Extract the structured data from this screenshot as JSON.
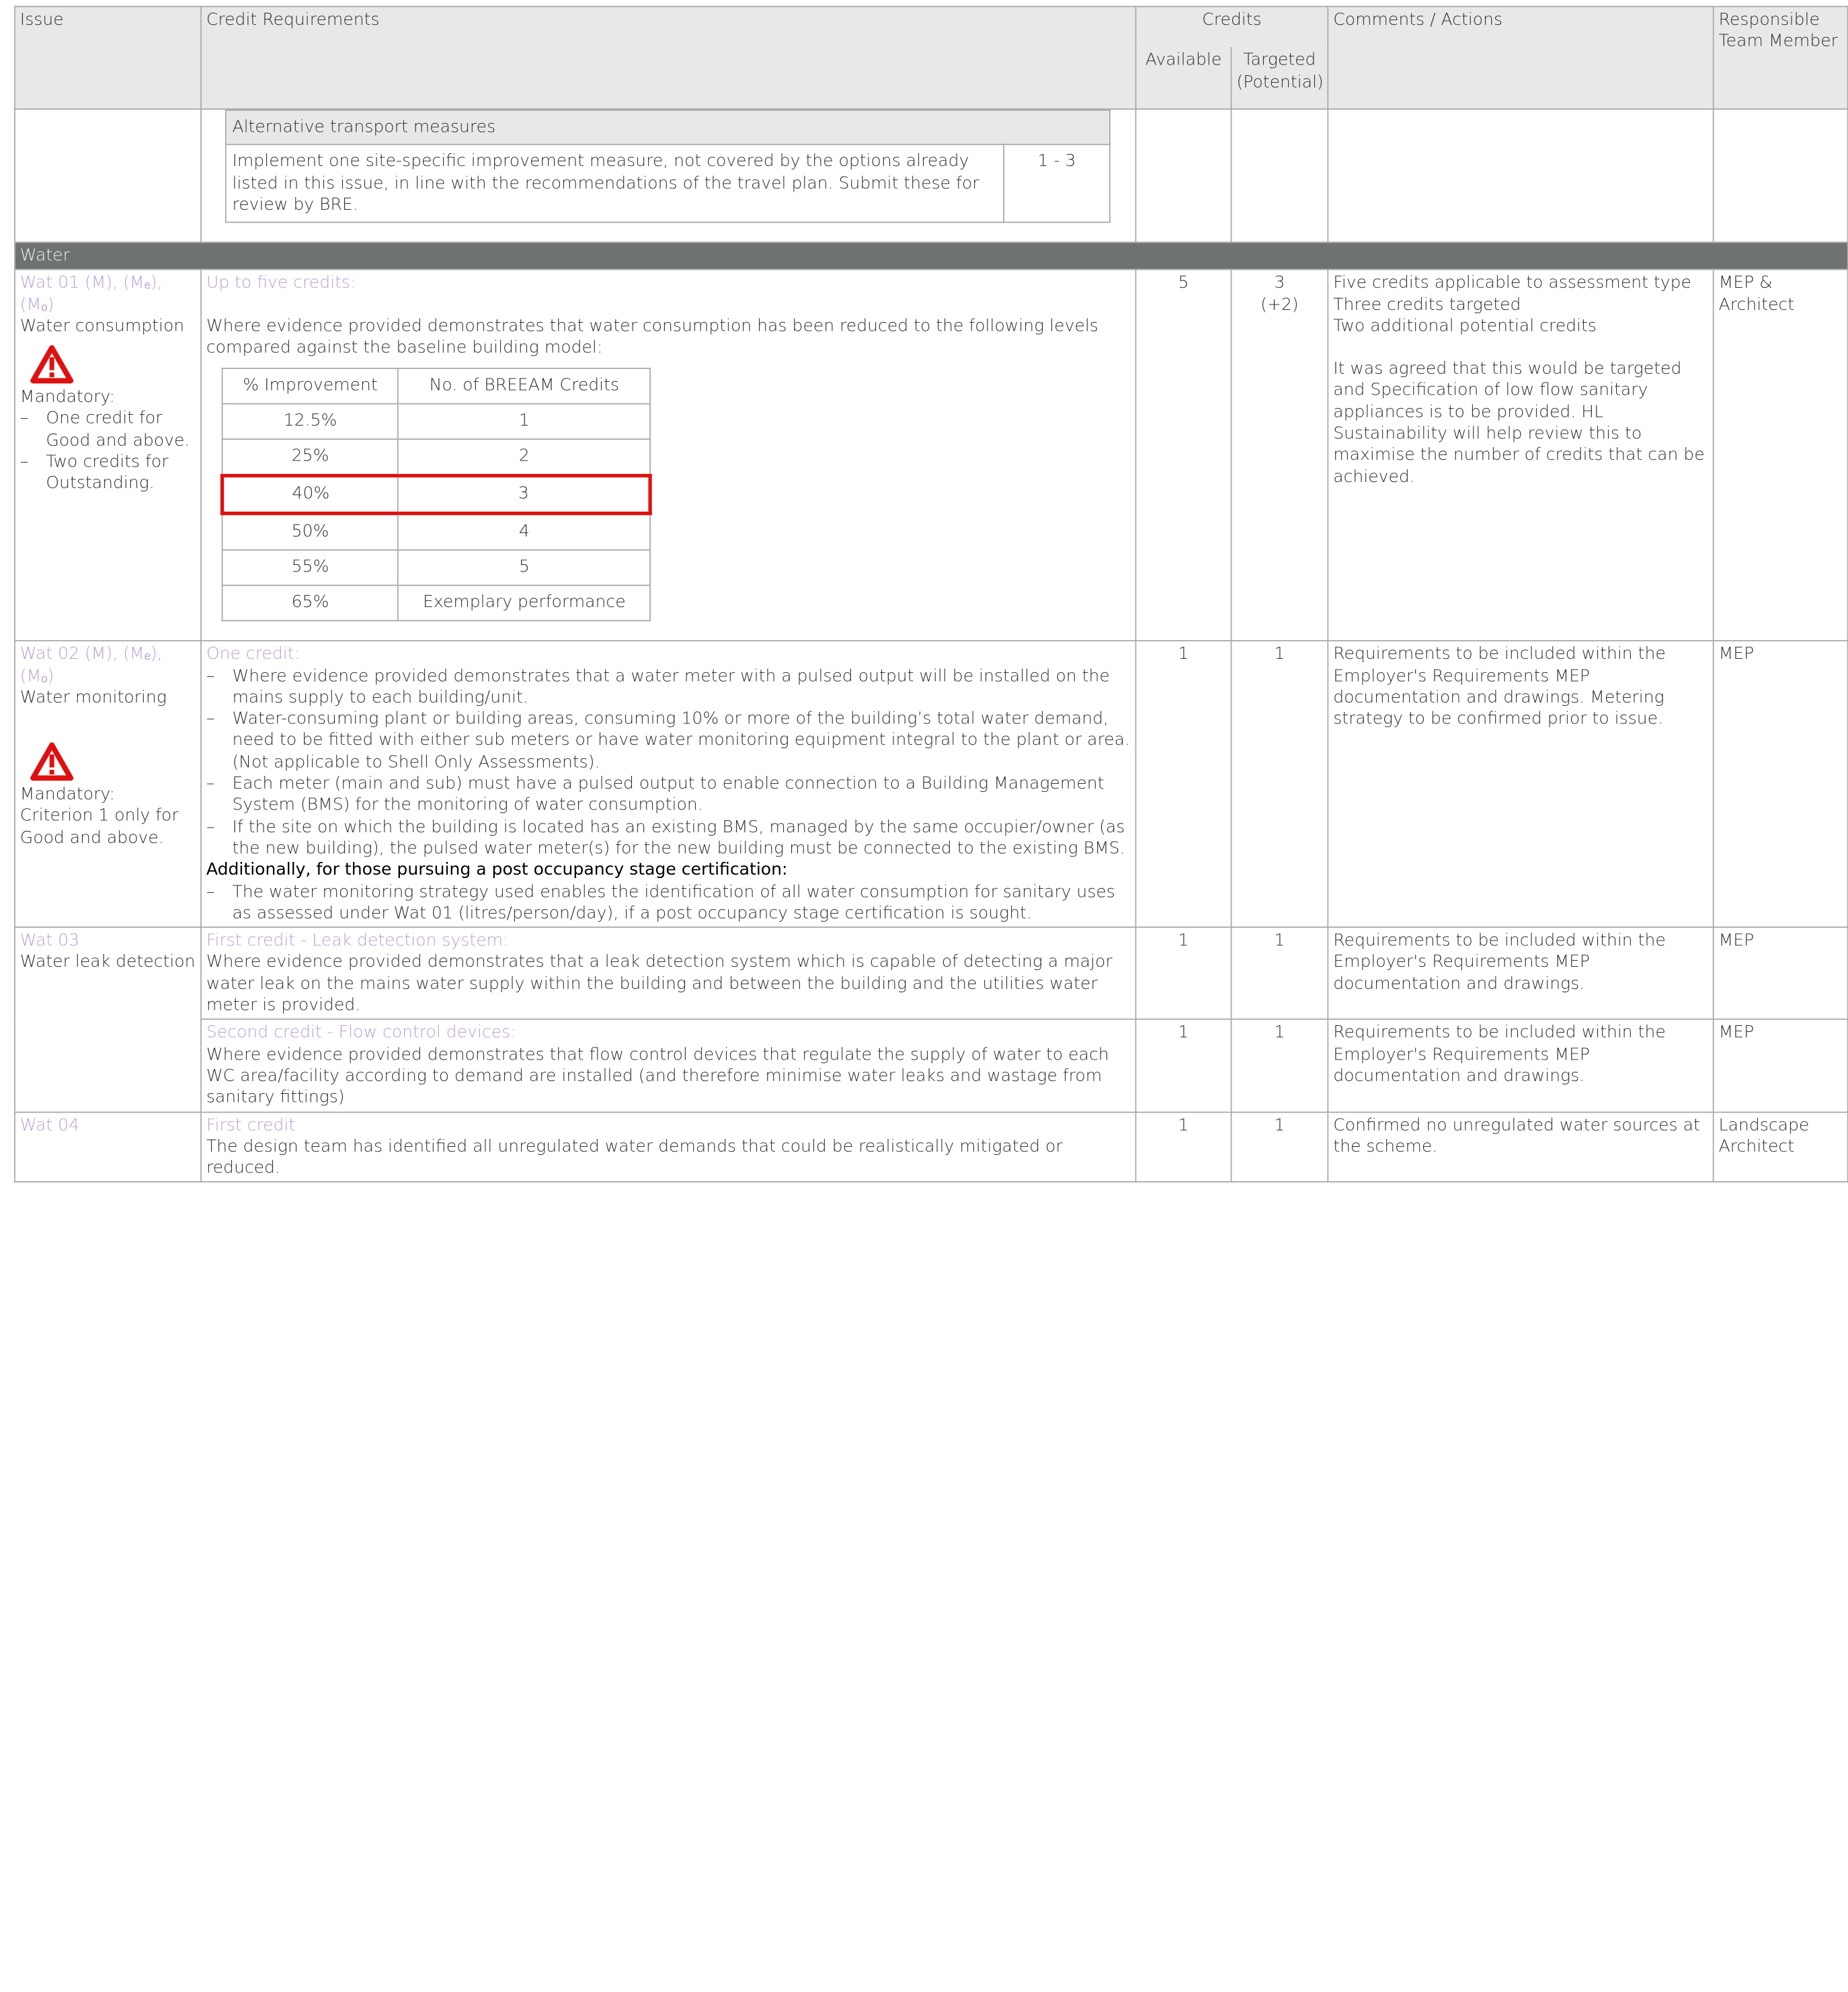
{
  "header": {
    "issue": "Issue",
    "credit_requirements": "Credit Requirements",
    "credits": "Credits",
    "available": "Available",
    "targeted": "Targeted",
    "potential": "(Potential)",
    "comments": "Comments / Actions",
    "responsible": "Responsible Team Member"
  },
  "alt_transport": {
    "title": "Alternative transport measures",
    "text": "Implement one site-specific improvement measure, not covered by the options already listed in this issue, in line with the recommendations of the travel plan. Submit these for review by BRE.",
    "credits": "1 - 3"
  },
  "section_water": "Water",
  "wat01": {
    "code": "Wat 01 (M), (Mₑ), (Mₒ)",
    "name": "Water consumption",
    "mandatory_title": "Mandatory:",
    "mandatory_items": [
      "One credit for Good and above.",
      "Two credits for Outstanding."
    ],
    "req_title": "Up to five credits:",
    "req_text": "Where evidence provided demonstrates that water consumption has been reduced to the following levels compared against the baseline building model:",
    "table_headers": [
      "% Improvement",
      "No. of BREEAM Credits"
    ],
    "table_rows": [
      [
        "12.5%",
        "1"
      ],
      [
        "25%",
        "2"
      ],
      [
        "40%",
        "3"
      ],
      [
        "50%",
        "4"
      ],
      [
        "55%",
        "5"
      ],
      [
        "65%",
        "Exemplary performance"
      ]
    ],
    "available": "5",
    "targeted": "3",
    "potential": "(+2)",
    "comments_1": "Five credits applicable to assessment type",
    "comments_2": "Three credits targeted",
    "comments_3": "Two additional potential credits",
    "comments_4": "It was agreed that this would be targeted and Specification of low flow sanitary appliances is to be provided. HL Sustainability will help review this to maximise the number of credits that can be achieved.",
    "responsible": "MEP & Architect"
  },
  "wat02": {
    "code": "Wat 02 (M), (Mₑ), (Mₒ)",
    "name": "Water monitoring",
    "mandatory_title": "Mandatory:",
    "mandatory_text": "Criterion 1 only for Good and above.",
    "req_title": "One credit:",
    "req_items": [
      "Where evidence provided demonstrates that a water meter with a pulsed output will be installed on the mains supply to each building/unit.",
      "Water-consuming plant or building areas, consuming 10% or more of the building’s total water demand, need to be fitted with either sub meters or have water monitoring equipment integral to the plant or area. (Not applicable to Shell Only Assessments).",
      "Each meter (main and sub) must have a pulsed output to enable connection to a Building Management System (BMS) for the monitoring of water consumption.",
      "If the site on which the building is located has an existing BMS, managed by the same occupier/owner (as the new building), the pulsed water meter(s) for the new building must be connected to the existing BMS."
    ],
    "additional_title": "Additionally, for those pursuing a post occupancy stage certification:",
    "additional_item": "The water monitoring strategy used enables the identification of all water consumption for sanitary uses as assessed under Wat 01 (litres/person/day), if a post occupancy stage certification is sought.",
    "available": "1",
    "targeted": "1",
    "comments": "Requirements to be included within the Employer's Requirements MEP documentation and drawings. Metering strategy to be confirmed prior to issue.",
    "responsible": "MEP"
  },
  "wat03": {
    "code": "Wat 03",
    "name": "Water leak detection",
    "first_title": "First credit - Leak detection system:",
    "first_text": "Where evidence provided demonstrates that a leak detection system which is capable of detecting a major water leak on the mains water supply within the building and between the building and the utilities water meter is provided.",
    "first_available": "1",
    "first_targeted": "1",
    "first_comments": "Requirements to be included within the Employer's Requirements MEP documentation and drawings.",
    "first_responsible": "MEP",
    "second_title": "Second credit - Flow control devices:",
    "second_text": "Where evidence provided demonstrates that flow control devices that regulate the supply of water to each WC area/facility according to demand are installed (and therefore minimise water leaks and wastage from sanitary fittings)",
    "second_available": "1",
    "second_targeted": "1",
    "second_comments": "Requirements to be included within the Employer's Requirements MEP documentation and drawings.",
    "second_responsible": "MEP"
  },
  "wat04": {
    "code": "Wat 04",
    "req_title": "First credit",
    "req_text": "The design team has identified all unregulated water demands that could be realistically mitigated or reduced.",
    "available": "1",
    "targeted": "1",
    "comments": "Confirmed no unregulated water sources at the scheme.",
    "responsible": "Landscape Architect"
  },
  "colors": {
    "section_bg": "#6f736f",
    "header_bg": "#e8e8e8",
    "accent_purple": "#b99fd4",
    "highlight_red": "#e01010"
  },
  "icons": [
    "warning-triangle-icon"
  ]
}
